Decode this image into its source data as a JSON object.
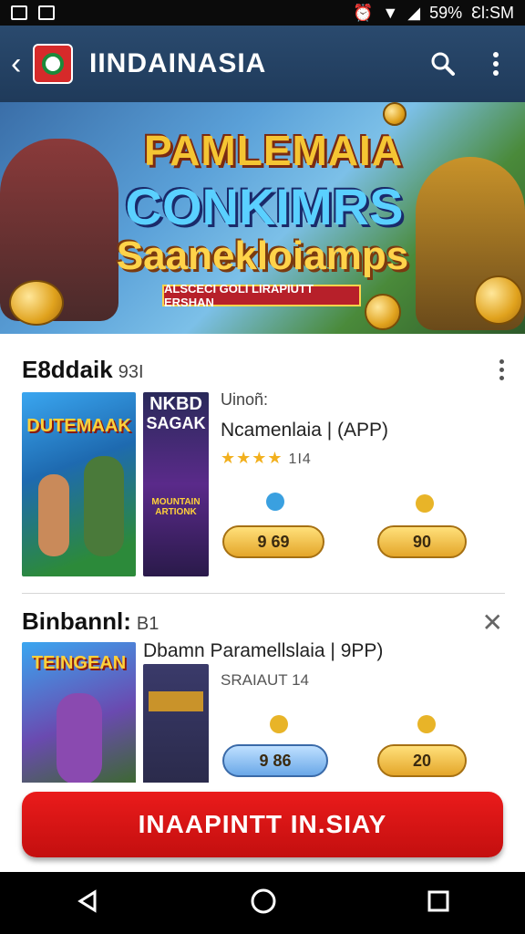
{
  "status_bar": {
    "battery": "59%",
    "time": "ƐƖ:SM"
  },
  "app_bar": {
    "title": "IINDAINASIA",
    "back_icon": "chevron-left-icon",
    "search_icon": "search-icon",
    "menu_icon": "more-vert-icon"
  },
  "banner": {
    "line1": "PAMLEMAIA",
    "line2": "CONKIMRS",
    "line3": "Saanekloiamps",
    "ribbon": "ALSCECI GOLI LIRAPIUTT ERSHAN"
  },
  "section1": {
    "title": "E8ddaik",
    "count": "93I",
    "cover1_title": "DUTEMAAK",
    "cover2_title_a": "NKBD",
    "cover2_title_b": "SAGAK",
    "cover2_sub": "MOUNTAIN ARTIONK",
    "line_top": "Uinoñ:",
    "line_title": "Ncamenlaia | (APP)",
    "rating_sub": "1I4",
    "badge1": "9 69",
    "badge2": "90",
    "stars": "★★★★"
  },
  "section2": {
    "title": "Binbannl:",
    "count": "B1",
    "cover1_title": "TEINGEAN",
    "line_title": "Dbamn Paramellslaia | 9PP)",
    "line_sub": "SRAIAUT 14",
    "badge1": "9 86",
    "badge2": "20"
  },
  "cta": {
    "label": "INAAPINTT IN.SIAY"
  },
  "colors": {
    "app_bar": "#1f3a5a",
    "cta": "#d81414",
    "gold": "#e4a62a"
  }
}
